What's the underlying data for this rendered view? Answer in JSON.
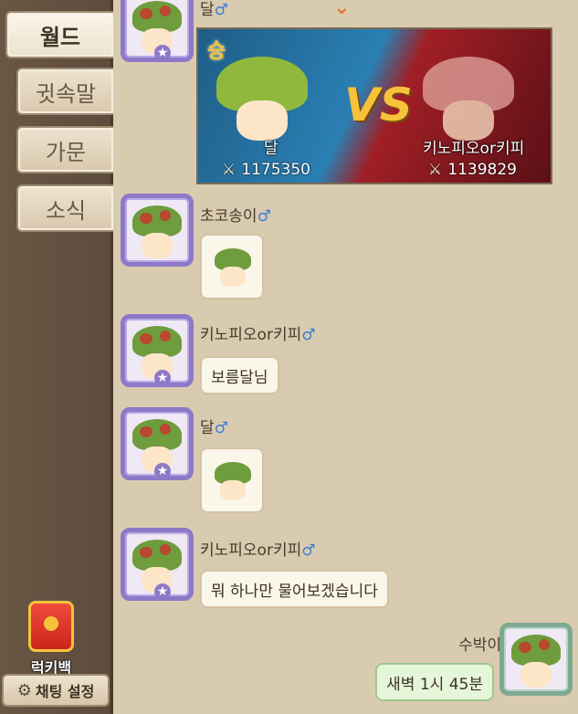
{
  "sidebar": {
    "tabs": [
      {
        "label": "월드"
      },
      {
        "label": "귓속말"
      },
      {
        "label": "가문"
      },
      {
        "label": "소식"
      }
    ],
    "lucky_bag_label": "럭키백",
    "chat_settings_label": "채팅 설정"
  },
  "chat": {
    "battle_post": {
      "sender": "달",
      "win_badge": "승",
      "vs_label": "VS",
      "left_name": "달",
      "left_score": "1175350",
      "right_name": "키노피오or키피",
      "right_score": "1139829"
    },
    "messages": [
      {
        "sender": "초코송이",
        "type": "sticker"
      },
      {
        "sender": "키노피오or키피",
        "type": "text",
        "text": "보름달님"
      },
      {
        "sender": "달",
        "type": "sticker"
      },
      {
        "sender": "키노피오or키피",
        "type": "text",
        "text": "뭐 하나만 물어보겠습니다"
      },
      {
        "sender": "수박이",
        "type": "text",
        "text": "새벽 1시 45분",
        "mine": true
      }
    ],
    "male_symbol": "♂"
  },
  "colors": {
    "avatar_border": "#8e79c8",
    "my_avatar_border": "#7fa890",
    "male_symbol": "#3a7ed6"
  },
  "icons": [
    "gear-icon",
    "sword-icon",
    "chevron-down-icon",
    "star-icon",
    "lucky-bag-icon"
  ]
}
